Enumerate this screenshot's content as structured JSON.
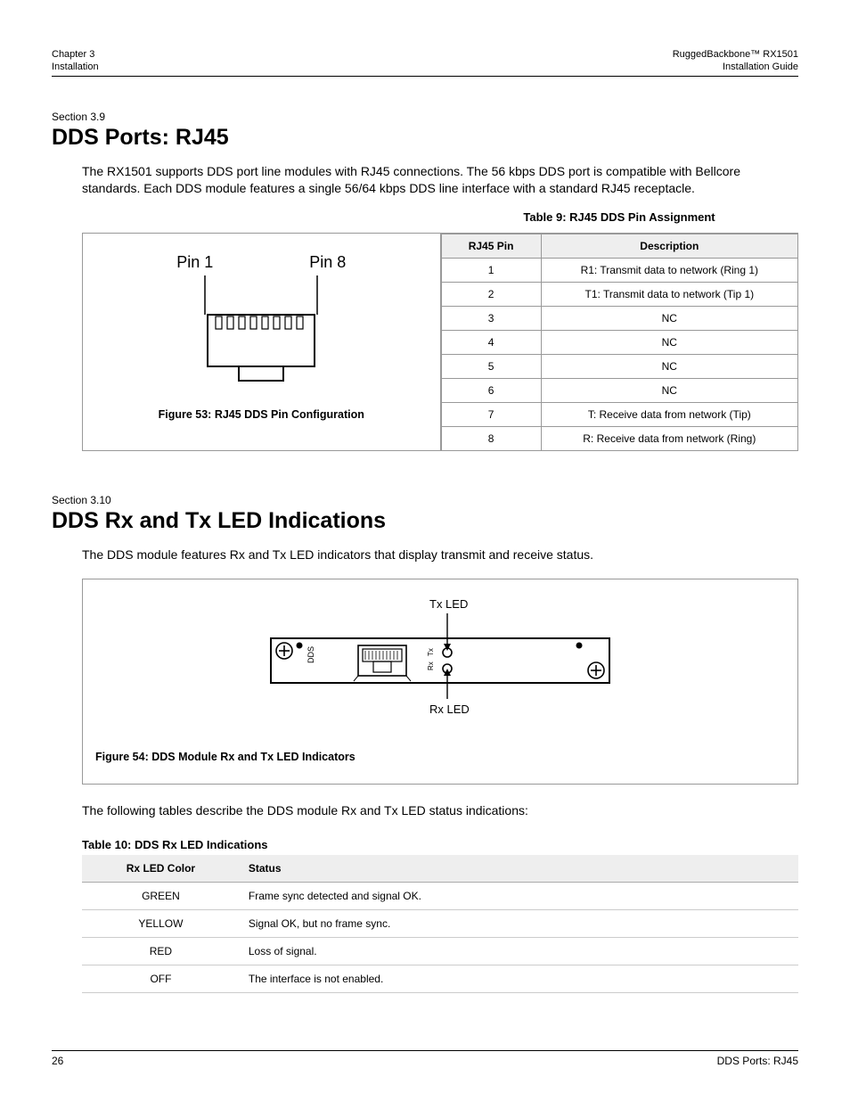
{
  "header": {
    "chapter": "Chapter 3",
    "section": "Installation",
    "product": "RuggedBackbone™ RX1501",
    "doc": "Installation Guide"
  },
  "sec_3_9": {
    "label": "Section 3.9",
    "title": "DDS Ports: RJ45",
    "para": "The RX1501 supports DDS port line modules with RJ45 connections. The 56 kbps DDS port is compatible with Bellcore standards. Each DDS module features a single 56/64 kbps DDS line interface with a standard RJ45 receptacle.",
    "figure": {
      "pin1": "Pin 1",
      "pin8": "Pin 8",
      "caption": "Figure 53: RJ45 DDS Pin Configuration"
    },
    "table9": {
      "caption": "Table 9: RJ45 DDS Pin Assignment",
      "head_pin": "RJ45 Pin",
      "head_desc": "Description",
      "rows": [
        {
          "pin": "1",
          "desc": "R1: Transmit data to network (Ring 1)"
        },
        {
          "pin": "2",
          "desc": "T1: Transmit data to network (Tip 1)"
        },
        {
          "pin": "3",
          "desc": "NC"
        },
        {
          "pin": "4",
          "desc": "NC"
        },
        {
          "pin": "5",
          "desc": "NC"
        },
        {
          "pin": "6",
          "desc": "NC"
        },
        {
          "pin": "7",
          "desc": "T: Receive data from network (Tip)"
        },
        {
          "pin": "8",
          "desc": "R: Receive data from network (Ring)"
        }
      ]
    }
  },
  "sec_3_10": {
    "label": "Section 3.10",
    "title": "DDS Rx and Tx LED Indications",
    "para": "The DDS module features Rx and Tx LED indicators that display transmit and receive status.",
    "figure": {
      "tx_led": "Tx LED",
      "rx_led": "Rx LED",
      "dds_label": "DDS",
      "tx_small": "Tx",
      "rx_small": "Rx",
      "caption": "Figure 54: DDS Module Rx and Tx LED Indicators"
    },
    "para2": "The following tables describe the DDS module Rx and Tx LED status indications:",
    "table10": {
      "caption": "Table 10: DDS Rx LED Indications",
      "head_color": "Rx LED Color",
      "head_status": "Status",
      "rows": [
        {
          "color": "GREEN",
          "status": "Frame sync detected and signal OK."
        },
        {
          "color": "YELLOW",
          "status": "Signal OK, but no frame sync."
        },
        {
          "color": "RED",
          "status": "Loss of signal."
        },
        {
          "color": "OFF",
          "status": "The interface is not enabled."
        }
      ]
    }
  },
  "footer": {
    "page": "26",
    "right": "DDS Ports: RJ45"
  }
}
